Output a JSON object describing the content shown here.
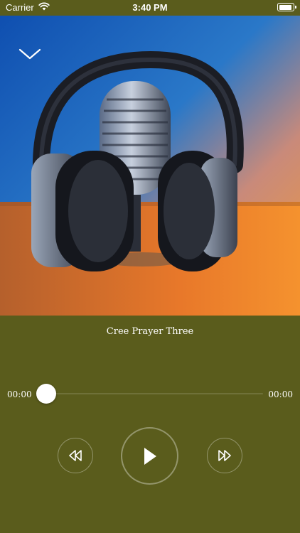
{
  "status_bar": {
    "carrier": "Carrier",
    "time": "3:40 PM",
    "battery_level": 0.9
  },
  "icons": {
    "wifi": "wifi-icon",
    "battery": "battery-icon",
    "collapse": "chevron-down-icon",
    "rewind": "rewind-icon",
    "play": "play-icon",
    "forward": "fast-forward-icon"
  },
  "colors": {
    "background": "#5a5c1c",
    "text": "#ffffff",
    "thumb": "#ffffff"
  },
  "player": {
    "title": "Cree Prayer Three",
    "elapsed": "00:00",
    "duration": "00:00",
    "progress_fraction": 0
  }
}
